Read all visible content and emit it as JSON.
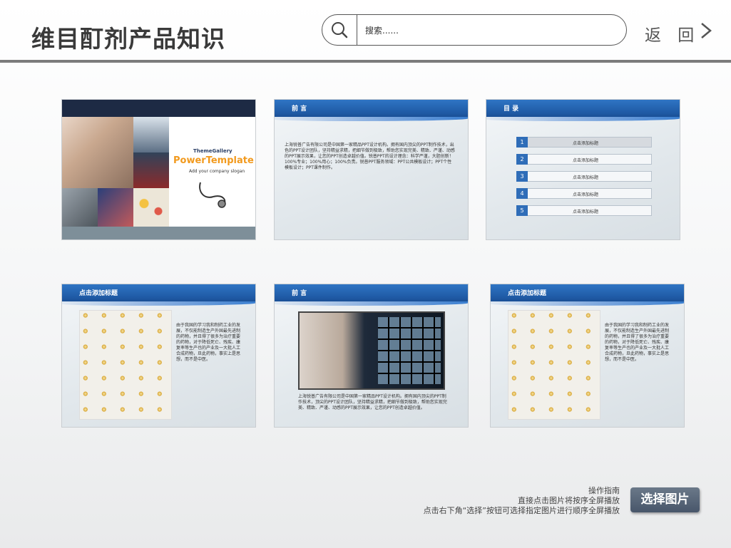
{
  "header": {
    "title": "维目酊剂产品知识",
    "back_label": "返 回"
  },
  "search": {
    "placeholder": "搜索......"
  },
  "slides": [
    {
      "logo": "ThemeGallery",
      "title": "PowerTemplate",
      "slogan": "Add your company slogan"
    },
    {
      "banner": "前 言",
      "text": "上海锐普广告有限公司是中国第一家精品PPT设计机构。拥有国内顶尖的PPT制作技术，出色的PPT设计团队，坚持精益求精，把细节做到极致，帮助您实现完美、精致、严谨、动感的PPT展示效果，让您的PPT创造卓越价值。锐普PPT的设计理念：科学严谨，大胆创新！100%专业；100%用心；100%负责。锐普PPT服务领域：PPT公共模板设计；PPT个性模板设计；PPT课件制作。"
    },
    {
      "banner": "目 录",
      "items": [
        {
          "num": "1",
          "label": "点击添加标题"
        },
        {
          "num": "2",
          "label": "点击添加标题"
        },
        {
          "num": "3",
          "label": "点击添加标题"
        },
        {
          "num": "4",
          "label": "点击添加标题"
        },
        {
          "num": "5",
          "label": "点击添加标题"
        }
      ]
    },
    {
      "banner": "点击添加标题",
      "text": "由于我国的学习我和制药工业的发展，不仅能制造生产外国最先进制的药物，并且得了很多为治疗重要的药物，对于降低死亡、残疾、康复率等生产也的产业及一大批人工合成药物，旦此药物，事实上是思想，而不是中医。"
    },
    {
      "banner": "前 言",
      "text": "上海锐普广告有限公司是中国第一家精品PPT设计机构。拥有国内顶尖的PPT制作技术，顶尖的PPT设计团队，坚持精益求精，把细节做到极致，帮助您实现完美、精致、严谨、动感的PPT展示效果，让您的PPT创造卓越价值。"
    },
    {
      "banner": "点击添加标题",
      "text": "由于我国的学习我和制药工业的发展，不仅能制造生产外国最先进制的药物，并且得了很多为治疗重要的药物，对于降低死亡、残疾、康复率等生产也的产业及一大批人工合成药物，旦此药物，事实上是思想，而不是中医。"
    }
  ],
  "guide": {
    "title": "操作指南",
    "line1": "直接点击图片将按序全屏播放",
    "line2": "点击右下角“选择”按钮可选择指定图片进行顺序全屏播放"
  },
  "select_button": "选择图片"
}
